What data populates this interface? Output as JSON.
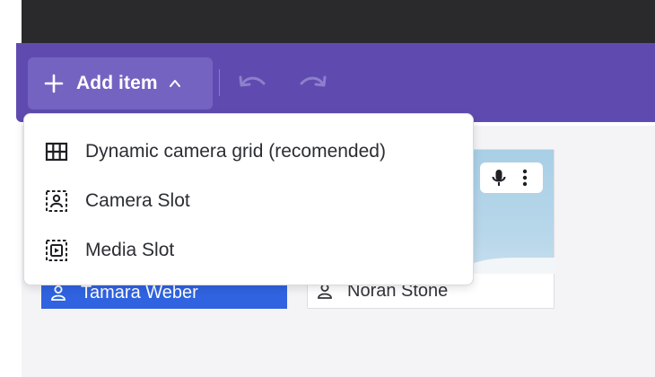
{
  "toolbar": {
    "add_item_label": "Add item",
    "icons": [
      "plus-icon",
      "chevron-up-icon",
      "undo-icon",
      "redo-icon"
    ]
  },
  "menu": {
    "items": [
      {
        "label": "Dynamic camera grid (recomended)",
        "icon": "grid-icon"
      },
      {
        "label": "Camera Slot",
        "icon": "camera-slot-icon"
      },
      {
        "label": "Media Slot",
        "icon": "media-slot-icon"
      }
    ]
  },
  "tiles": [
    {
      "name": "Tamara Weber",
      "icon": "person-icon"
    },
    {
      "name": "Noran Stone",
      "icon": "person-icon"
    }
  ],
  "colors": {
    "toolbar": "#5f4bb0",
    "add_button": "#7563c2",
    "active_tile": "#2f63e0",
    "top_bar": "#2a2a2c"
  }
}
